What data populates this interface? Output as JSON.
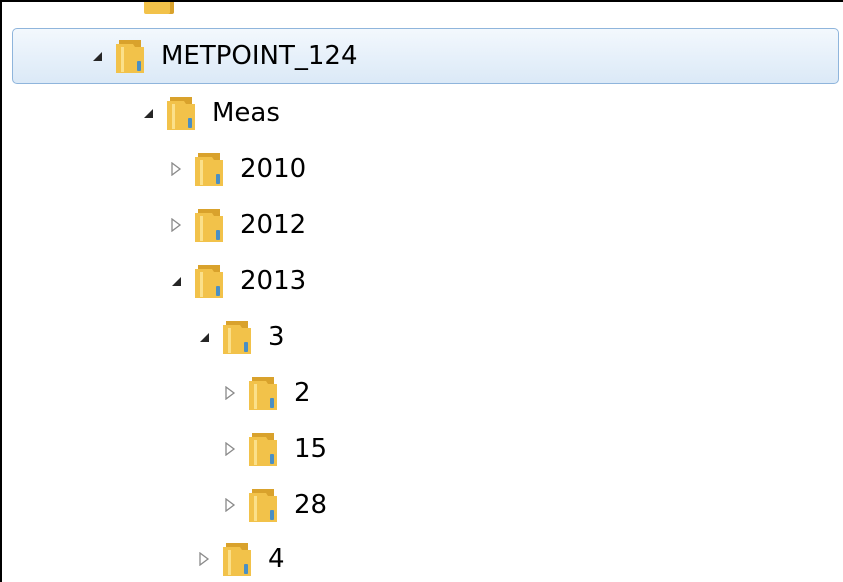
{
  "tree": {
    "nodes": [
      {
        "label": "METPOINT_124",
        "expanded": true,
        "selected": true
      },
      {
        "label": "Meas",
        "expanded": true
      },
      {
        "label": "2010",
        "expanded": false
      },
      {
        "label": "2012",
        "expanded": false
      },
      {
        "label": "2013",
        "expanded": true
      },
      {
        "label": "3",
        "expanded": true
      },
      {
        "label": "2",
        "expanded": false
      },
      {
        "label": "15",
        "expanded": false
      },
      {
        "label": "28",
        "expanded": false
      },
      {
        "label": "4",
        "expanded": false
      }
    ]
  },
  "colors": {
    "folder_front": "#f2c24a",
    "folder_back": "#d9a22c",
    "selection_border": "#8fb5dc",
    "selection_fill": "#dbe9f7"
  },
  "icons": {
    "expanded": "expanded-triangle-icon",
    "collapsed": "collapsed-triangle-icon",
    "folder": "folder-icon"
  }
}
